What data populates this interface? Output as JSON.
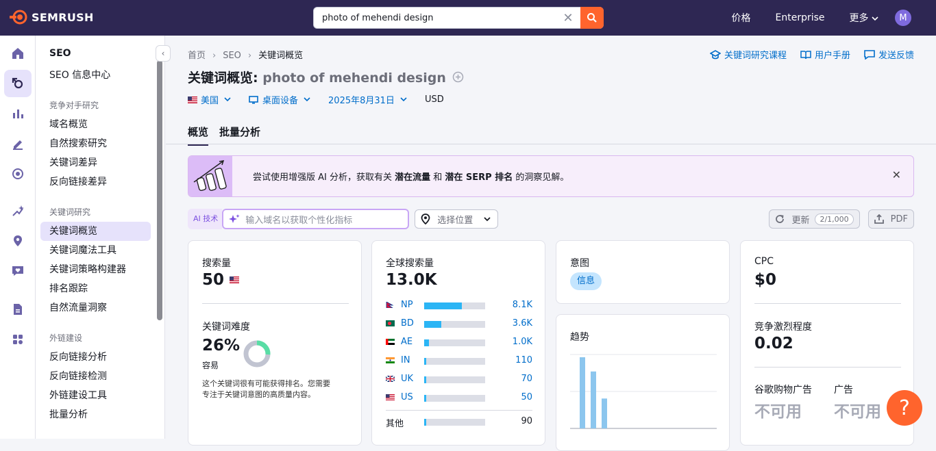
{
  "brand": "SEMRUSH",
  "search": {
    "value": "photo of mehendi design"
  },
  "topnav": {
    "pricing": "价格",
    "enterprise": "Enterprise",
    "more": "更多",
    "avatar": "M"
  },
  "sidebar": {
    "head": "SEO",
    "hub": "SEO 信息中心",
    "sections": [
      {
        "title": "竞争对手研究",
        "items": [
          "域名概览",
          "自然搜索研究",
          "关键词差异",
          "反向链接差异"
        ]
      },
      {
        "title": "关键词研究",
        "items": [
          "关键词概览",
          "关键词魔法工具",
          "关键词策略构建器",
          "排名跟踪",
          "自然流量洞察"
        ]
      },
      {
        "title": "外链建设",
        "items": [
          "反向链接分析",
          "反向链接检测",
          "外链建设工具",
          "批量分析"
        ]
      }
    ]
  },
  "breadcrumb": [
    "首页",
    "SEO",
    "关键词概览"
  ],
  "header_links": [
    "关键词研究课程",
    "用户手册",
    "发送反馈"
  ],
  "title": {
    "prefix": "关键词概览:",
    "keyword": "photo of mehendi design"
  },
  "filters": {
    "country": "美国",
    "device": "桌面设备",
    "date": "2025年8月31日",
    "currency": "USD"
  },
  "tabs": [
    "概览",
    "批量分析"
  ],
  "banner": {
    "pre": "尝试使用增强版 AI 分析，获取有关 ",
    "b1": "潜在流量",
    "mid": " 和 ",
    "b2": "潜在 SERP 排名",
    "post": " 的洞察见解。"
  },
  "ai": {
    "tag": "AI 技术",
    "placeholder": "输入域名以获取个性化指标",
    "location": "选择位置"
  },
  "actions": {
    "update": "更新",
    "count": "2/1,000",
    "pdf": "PDF"
  },
  "volume": {
    "label": "搜索量",
    "value": "50"
  },
  "difficulty": {
    "label": "关键词难度",
    "value": "26%",
    "level": "容易",
    "percent": 26,
    "desc1": "这个关键词很有可能获得排名。您需要",
    "desc2": "专注于关键词意图的高质量内容。"
  },
  "global": {
    "label": "全球搜索量",
    "value": "13.0K",
    "rows": [
      {
        "code": "NP",
        "value": "8.1K",
        "share": 0.62
      },
      {
        "code": "BD",
        "value": "3.6K",
        "share": 0.28
      },
      {
        "code": "AE",
        "value": "1.0K",
        "share": 0.08
      },
      {
        "code": "IN",
        "value": "110",
        "share": 0.02
      },
      {
        "code": "UK",
        "value": "70",
        "share": 0.02
      },
      {
        "code": "US",
        "value": "50",
        "share": 0.02
      }
    ],
    "other_label": "其他",
    "other_value": "90",
    "other_share": 0.02
  },
  "intent": {
    "label": "意图",
    "badge": "信息"
  },
  "trend": {
    "label": "趋势",
    "values": [
      1.0,
      0.8,
      0.42
    ]
  },
  "cpc": {
    "label": "CPC",
    "value": "$0"
  },
  "competition": {
    "label": "竞争激烈程度",
    "value": "0.02"
  },
  "shopping": {
    "label": "谷歌购物广告",
    "value": "不可用"
  },
  "ads": {
    "label": "广告",
    "value": "不可用"
  },
  "colors": {
    "brand_orange": "#ff642d",
    "topbar": "#2e2753",
    "link": "#006dca",
    "bar": "#2bb5f5"
  }
}
